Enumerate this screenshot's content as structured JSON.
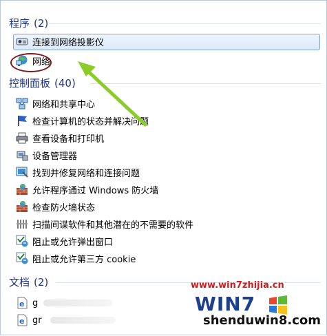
{
  "sections": {
    "programs": {
      "title": "程序",
      "count": "(2)"
    },
    "control_panel": {
      "title": "控制面板",
      "count": "(40)"
    },
    "documents": {
      "title": "文档",
      "count": "(2)"
    }
  },
  "programs": [
    {
      "label": "连接到网络投影仪",
      "icon": "projector-icon",
      "selected": true
    },
    {
      "label": "网络",
      "icon": "network-icon",
      "selected": false
    }
  ],
  "control_panel": [
    {
      "label": "网络和共享中心",
      "icon": "network-sharing-icon"
    },
    {
      "label": "检查计算机的状态并解决问题",
      "icon": "action-center-flag-icon"
    },
    {
      "label": "查看设备和打印机",
      "icon": "printer-icon"
    },
    {
      "label": "设备管理器",
      "icon": "device-manager-icon"
    },
    {
      "label": "找到并修复网络和连接问题",
      "icon": "troubleshoot-icon"
    },
    {
      "label": "允许程序通过 Windows 防火墙",
      "icon": "firewall-icon"
    },
    {
      "label": "检查防火墙状态",
      "icon": "firewall-icon"
    },
    {
      "label": "扫描间谍软件和其他潜在的不需要的软件",
      "icon": "defender-icon"
    },
    {
      "label": "阻止或允许弹出窗口",
      "icon": "ie-options-icon"
    },
    {
      "label": "阻止或允许第三方 cookie",
      "icon": "ie-options-icon"
    }
  ],
  "documents": [
    {
      "label": "g",
      "icon": "ie-document-icon"
    },
    {
      "label": "gr",
      "icon": "ie-document-icon"
    }
  ],
  "watermark": {
    "url": "www.win7zhijia.cn",
    "logo_text": "WIN7",
    "site": "shenduwin8.com"
  },
  "colors": {
    "section": "#1e3287",
    "selection_border": "#7da2ce",
    "annotation_oval": "#7b1818",
    "arrow": "#8ccc2a",
    "watermark_url": "#d11a1a"
  }
}
